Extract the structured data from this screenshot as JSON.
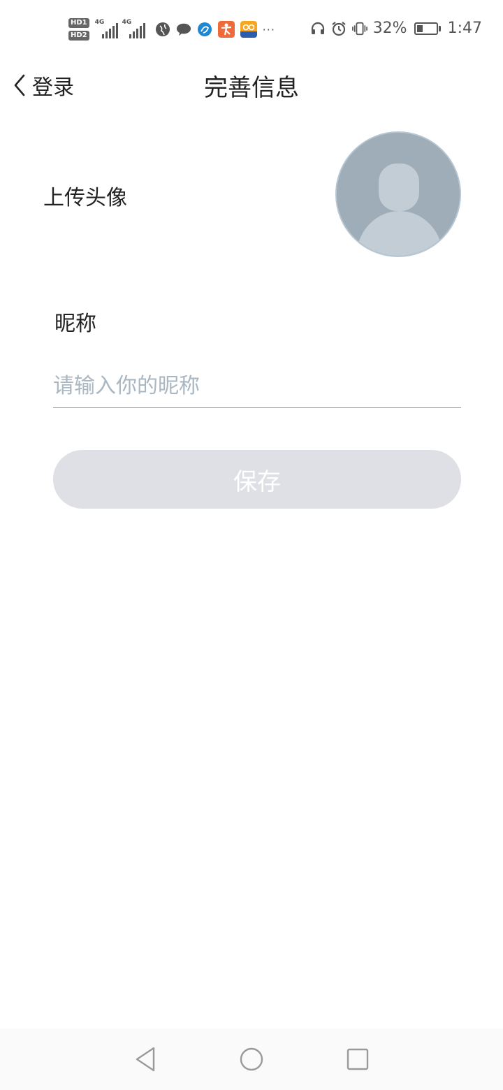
{
  "status_bar": {
    "sim1_badge": "HD1",
    "sim2_badge": "HD2",
    "net1": "4G",
    "net2": "4G",
    "more": "···",
    "battery_percent": "32%",
    "battery_level": 0.32,
    "time": "1:47"
  },
  "header": {
    "back_label": "登录",
    "title": "完善信息"
  },
  "avatar": {
    "label": "上传头像"
  },
  "nickname": {
    "label": "昵称",
    "placeholder": "请输入你的昵称",
    "value": ""
  },
  "actions": {
    "save_label": "保存"
  },
  "colors": {
    "button_disabled_bg": "#dfe0e5",
    "placeholder": "#a9b7c2",
    "avatar_bg": "#9eadb8"
  }
}
